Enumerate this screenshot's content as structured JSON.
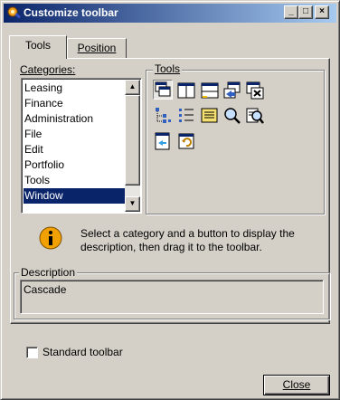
{
  "window": {
    "title": "Customize toolbar",
    "minimize_glyph": "_",
    "maximize_glyph": "□",
    "close_glyph": "×"
  },
  "tabs": [
    {
      "label": "Tools",
      "active": true
    },
    {
      "label": "Position",
      "active": false
    }
  ],
  "categories": {
    "label": "Categories:",
    "items": [
      "Leasing",
      "Finance",
      "Administration",
      "File",
      "Edit",
      "Portfolio",
      "Tools",
      "Window"
    ],
    "selected": "Window",
    "scroll_up": "▲",
    "scroll_down": "▼"
  },
  "tools_group": {
    "label": "Tools",
    "icons": [
      "cascade-icon",
      "tile-horizontal-icon",
      "tile-vertical-icon",
      "arrange-icons-icon",
      "close-windows-icon",
      "tree-view-icon",
      "list-view-icon",
      "detail-view-icon",
      "find-icon",
      "find-next-icon",
      "new-window-icon",
      "refresh-window-icon"
    ],
    "selected_icon": "cascade-icon"
  },
  "info": {
    "text": "Select a category and a button to display the description, then drag it to the toolbar."
  },
  "description": {
    "label": "Description",
    "value": "Cascade"
  },
  "standard_toolbar": {
    "label": "Standard toolbar",
    "checked": false
  },
  "close_button": {
    "label": "Close"
  },
  "colors": {
    "titlebar_start": "#0a246a",
    "titlebar_end": "#a6caf0",
    "selection": "#0a246a",
    "face": "#d4d0c8"
  }
}
